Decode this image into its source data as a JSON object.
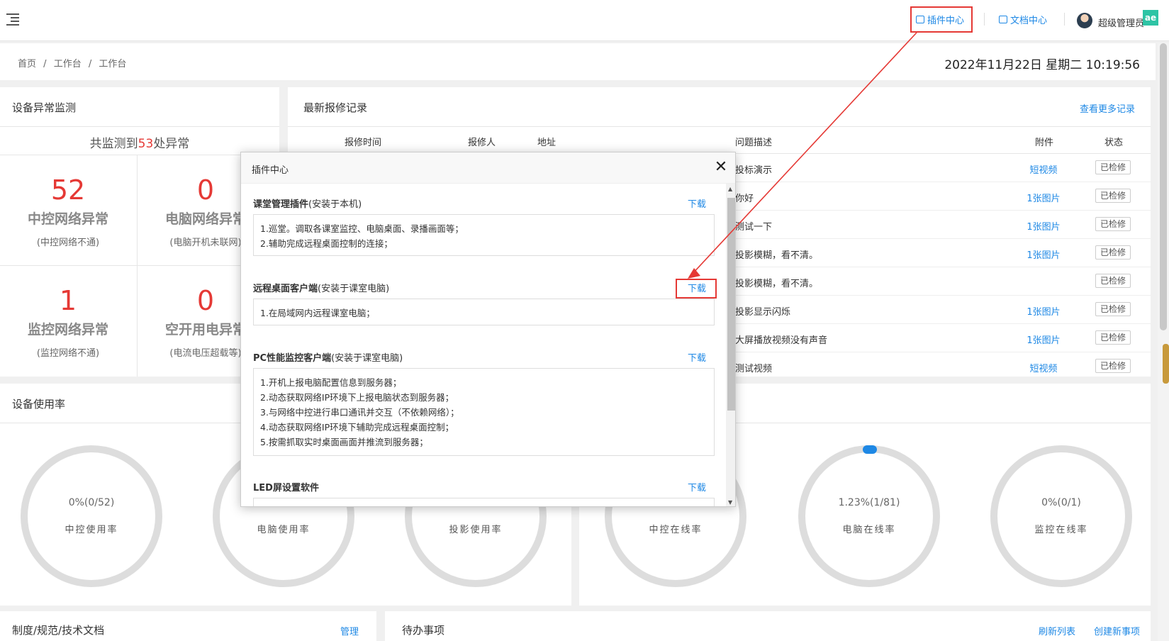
{
  "topbar": {
    "plugin_center": "插件中心",
    "doc_center": "文档中心",
    "user_name": "超级管理员",
    "badge": "ae"
  },
  "breadcrumb": [
    "首页",
    "/",
    "工作台",
    "/",
    "工作台"
  ],
  "datetime": "2022年11月22日  星期二  10:19:56",
  "monitor": {
    "title": "设备异常监测",
    "summary_prefix": "共监测到",
    "summary_count": "53",
    "summary_suffix": "处异常",
    "stats": [
      {
        "num": "52",
        "label": "中控网络异常",
        "sub": "(中控网络不通)"
      },
      {
        "num": "0",
        "label": "电脑网络异常",
        "sub": "(电脑开机未联网)"
      },
      {
        "num": "1",
        "label": "监控网络异常",
        "sub": "(监控网络不通)"
      },
      {
        "num": "0",
        "label": "空开用电异常",
        "sub": "(电流电压超载等)"
      }
    ]
  },
  "repair": {
    "title": "最新报修记录",
    "more": "查看更多记录",
    "headers": {
      "time": "报修时间",
      "person": "报修人",
      "addr": "地址",
      "desc": "问题描述",
      "att": "附件",
      "status": "状态"
    },
    "rows": [
      {
        "desc": "投标演示",
        "att": "短视频",
        "status": "已检修"
      },
      {
        "desc": "你好",
        "att": "1张图片",
        "status": "已检修"
      },
      {
        "desc": "测试一下",
        "att": "1张图片",
        "status": "已检修"
      },
      {
        "desc": "投影模糊，看不清。",
        "att": "1张图片",
        "status": "已检修"
      },
      {
        "desc": "投影模糊，看不清。",
        "att": "",
        "status": "已检修"
      },
      {
        "desc": "投影显示闪烁",
        "att": "1张图片",
        "status": "已检修"
      },
      {
        "desc": "大屏播放视频没有声音",
        "att": "1张图片",
        "status": "已检修"
      },
      {
        "desc": "测试视频",
        "att": "短视频",
        "status": "已检修"
      }
    ]
  },
  "usage": {
    "title": "设备使用率",
    "rings": [
      {
        "pct": "0%(0/52)",
        "label": "中控使用率"
      },
      {
        "pct": "",
        "label": "电脑使用率"
      },
      {
        "pct": "",
        "label": "投影使用率"
      },
      {
        "pct": "",
        "label": "中控在线率"
      },
      {
        "pct": "1.23%(1/81)",
        "label": "电脑在线率"
      },
      {
        "pct": "0%(0/1)",
        "label": "监控在线率"
      }
    ]
  },
  "docs": {
    "title": "制度/规范/技术文档",
    "manage": "管理"
  },
  "todo": {
    "title": "待办事项",
    "refresh": "刷新列表",
    "create": "创建新事项"
  },
  "modal": {
    "title": "插件中心",
    "plugins": [
      {
        "name": "课堂管理插件",
        "note": "(安装于本机)",
        "download": "下载",
        "lines": [
          "1.巡堂。调取各课室监控、电脑桌面、录播画面等；",
          "2.辅助完成远程桌面控制的连接；"
        ]
      },
      {
        "name": "远程桌面客户端",
        "note": "(安装于课室电脑)",
        "download": "下载",
        "lines": [
          "1.在局域网内远程课室电脑；"
        ]
      },
      {
        "name": "PC性能监控客户端",
        "note": "(安装于课室电脑)",
        "download": "下载",
        "lines": [
          "1.开机上报电脑配置信息到服务器；",
          "2.动态获取网络IP环境下上报电脑状态到服务器；",
          "3.与网络中控进行串口通讯并交互（不依赖网络）；",
          "4.动态获取网络IP环境下辅助完成远程桌面控制；",
          "5.按需抓取实时桌面画面并推流到服务器；"
        ]
      },
      {
        "name": "LED屏设置软件",
        "note": "",
        "download": "下载",
        "lines": []
      }
    ]
  },
  "colors": {
    "accent": "#1e88e5",
    "alert": "#e53935",
    "badge": "#2ec4a5"
  }
}
